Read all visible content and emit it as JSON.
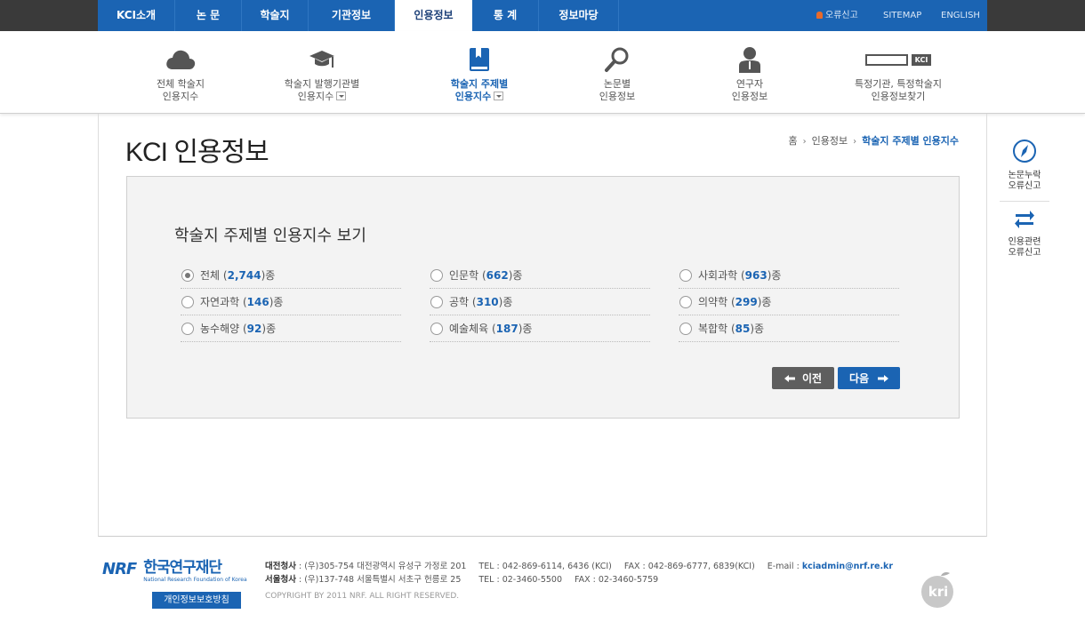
{
  "topnav": {
    "items": [
      "KCI소개",
      "논 문",
      "학술지",
      "기관정보",
      "인용정보",
      "통 계",
      "정보마당"
    ],
    "active_index": 4,
    "util": [
      "오류신고",
      "SITEMAP",
      "ENGLISH"
    ]
  },
  "subnav": {
    "items": [
      {
        "line1": "전체 학술지",
        "line2": "인용지수",
        "icon": "cloud-icon"
      },
      {
        "line1": "학술지 발행기관별",
        "line2": "인용지수",
        "icon": "graduation-cap-icon"
      },
      {
        "line1": "학술지 주제별",
        "line2": "인용지수",
        "icon": "book-icon"
      },
      {
        "line1": "논문별",
        "line2": "인용정보",
        "icon": "magnifier-icon"
      },
      {
        "line1": "연구자",
        "line2": "인용정보",
        "icon": "person-icon"
      },
      {
        "line1": "특정기관, 특정학술지",
        "line2": "인용정보찾기",
        "icon": "kci-search-icon"
      }
    ],
    "kci_badge": "KCI"
  },
  "page": {
    "title": "KCI 인용정보",
    "breadcrumb": [
      "홈",
      "인용정보",
      "학술지 주제별 인용지수"
    ]
  },
  "content": {
    "heading": "학술지 주제별 인용지수 보기",
    "categories": [
      {
        "name": "전체",
        "count": "2,744",
        "unit": "종",
        "selected": true
      },
      {
        "name": "인문학",
        "count": "662",
        "unit": "종",
        "selected": false
      },
      {
        "name": "사회과학",
        "count": "963",
        "unit": "종",
        "selected": false
      },
      {
        "name": "자연과학",
        "count": "146",
        "unit": "종",
        "selected": false
      },
      {
        "name": "공학",
        "count": "310",
        "unit": "종",
        "selected": false
      },
      {
        "name": "의약학",
        "count": "299",
        "unit": "종",
        "selected": false
      },
      {
        "name": "농수해양",
        "count": "92",
        "unit": "종",
        "selected": false
      },
      {
        "name": "예술체육",
        "count": "187",
        "unit": "종",
        "selected": false
      },
      {
        "name": "복합학",
        "count": "85",
        "unit": "종",
        "selected": false
      }
    ],
    "prev_label": "이전",
    "next_label": "다음"
  },
  "quick": [
    {
      "line1": "논문누락",
      "line2": "오류신고",
      "icon": "compass-icon"
    },
    {
      "line1": "인용관련",
      "line2": "오류신고",
      "icon": "exchange-icon"
    }
  ],
  "footer": {
    "logo_text": "한국연구재단",
    "logo_sub": "National Research Foundation of Korea",
    "logo_mark": "NRF",
    "privacy": "개인정보보호방침",
    "daejeon_label": "대전청사",
    "daejeon_addr": " : (우)305-754 대전광역시 유성구 가정로 201",
    "daejeon_tel": "TEL : 042-869-6114, 6436 (KCI)",
    "daejeon_fax": "FAX : 042-869-6777, 6839(KCI)",
    "email_label": "E-mail : ",
    "email": "kciadmin@nrf.re.kr",
    "seoul_label": "서울청사",
    "seoul_addr": " : (우)137-748 서울특별시 서초구 헌릉로 25",
    "seoul_tel": "TEL : 02-3460-5500",
    "seoul_fax": "FAX : 02-3460-5759",
    "copyright": "COPYRIGHT BY 2011 NRF. ALL RIGHT RESERVED.",
    "kri": "kri"
  },
  "colors": {
    "brand_blue": "#1b64b3",
    "dark_bar": "#3a3a3a",
    "prev_button": "#5e5e5e"
  }
}
